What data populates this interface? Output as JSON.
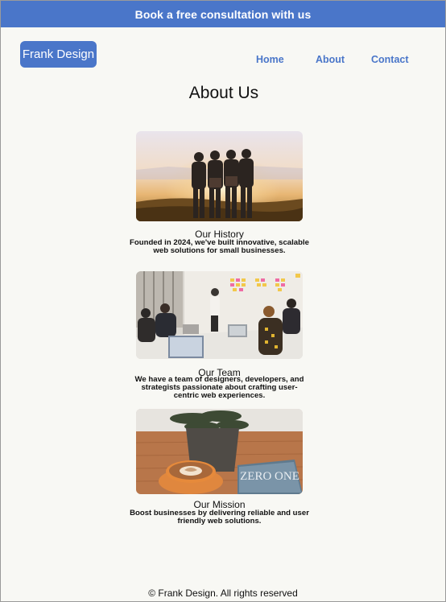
{
  "banner": {
    "cta_label": "Book a free consultation with us"
  },
  "header": {
    "logo_text": "Frank Design",
    "nav": {
      "home": "Home",
      "about": "About",
      "contact": "Contact"
    }
  },
  "main": {
    "title": "About Us",
    "sections": [
      {
        "title": "Our History",
        "text": "Founded in 2024, we've built innovative, scalable web solutions for  small businesses.",
        "image": "friends-sunset-photo"
      },
      {
        "title": "Our  Team",
        "text": "We have a team of designers, developers, and strategists passionate about crafting user-centric web experiences.",
        "image": "team-meeting-photo"
      },
      {
        "title": "Our Mission",
        "text": "Boost businesses by delivering reliable and user friendly web solutions.",
        "image": "coffee-plant-photo"
      }
    ]
  },
  "mission_image": {
    "book_cover_text": "ZERO ONE"
  },
  "footer": {
    "copyright": "© Frank Design. All rights reserved"
  },
  "colors": {
    "accent": "#4a76c9",
    "background": "#f8f8f4",
    "text": "#111111"
  }
}
